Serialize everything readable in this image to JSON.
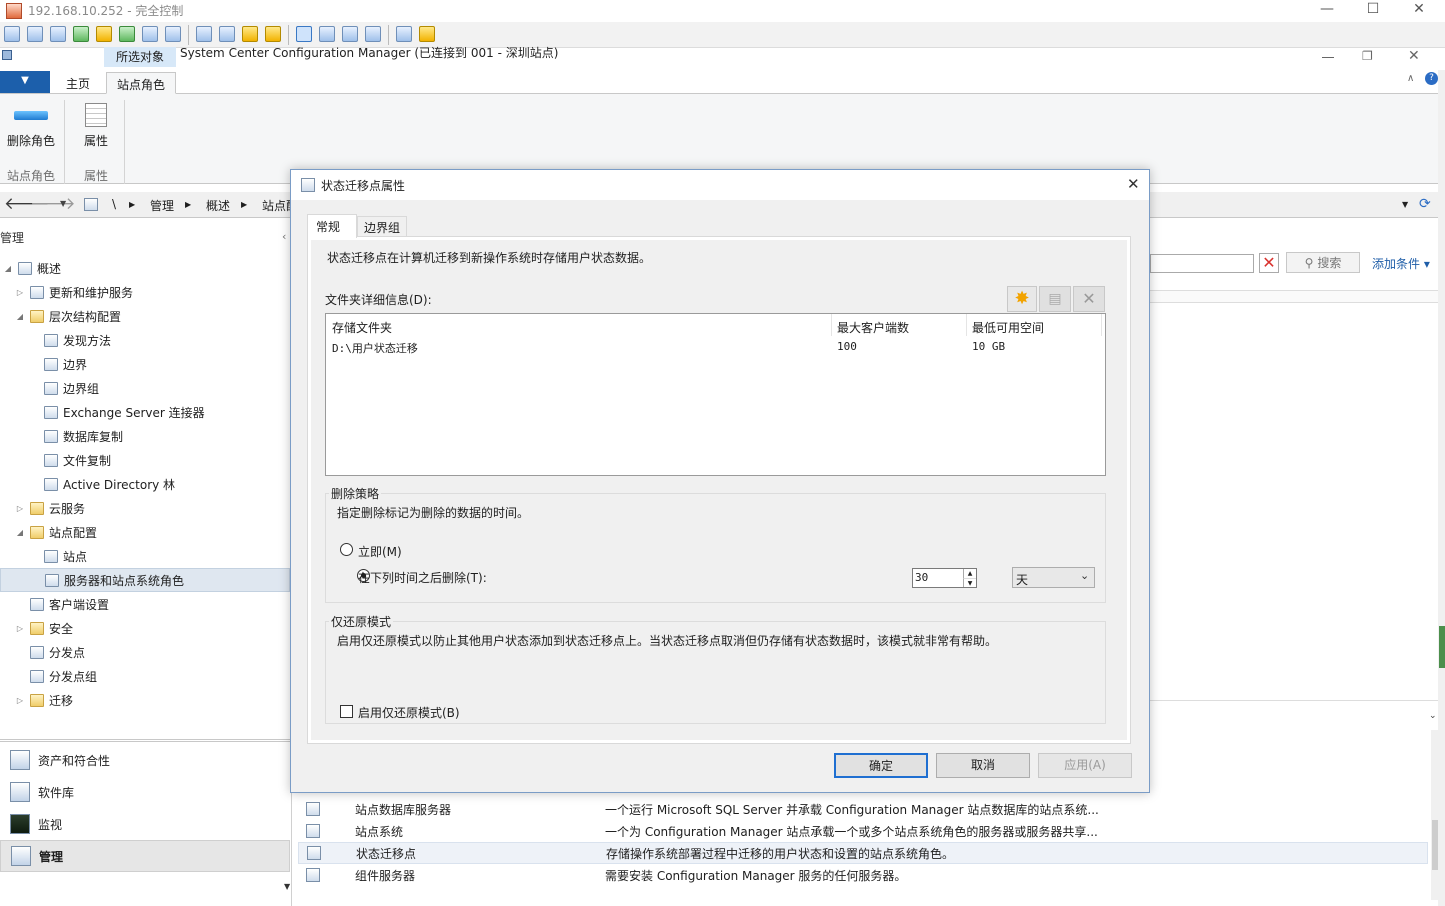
{
  "remote_window": {
    "title": "192.168.10.252 - 完全控制",
    "minimize": "—",
    "maximize": "☐",
    "close": "✕"
  },
  "app": {
    "title": "System Center Configuration Manager (已连接到 001 - 深圳站点)",
    "restore": "❐",
    "close": "✕"
  },
  "ribbon": {
    "file_button": "▼",
    "context_tab": "所选对象",
    "tabs": [
      "主页",
      "站点角色"
    ],
    "groups": [
      {
        "button": "删除角色",
        "label": "站点角色"
      },
      {
        "button": "属性",
        "label": "属性"
      }
    ]
  },
  "address": {
    "root": "\\",
    "crumbs": [
      "管理",
      "概述",
      "站点配"
    ]
  },
  "nav": {
    "header": "管理",
    "tree": [
      {
        "label": "概述",
        "level": 0,
        "exp": "◢",
        "icon": "overview-icon"
      },
      {
        "label": "更新和维护服务",
        "level": 1,
        "exp": "▷",
        "icon": "update-icon"
      },
      {
        "label": "层次结构配置",
        "level": 1,
        "exp": "◢",
        "icon": "folder-icon"
      },
      {
        "label": "发现方法",
        "level": 2,
        "exp": "",
        "icon": "discovery-icon"
      },
      {
        "label": "边界",
        "level": 2,
        "exp": "",
        "icon": "boundary-icon"
      },
      {
        "label": "边界组",
        "level": 2,
        "exp": "",
        "icon": "boundary-group-icon"
      },
      {
        "label": "Exchange Server 连接器",
        "level": 2,
        "exp": "",
        "icon": "exchange-icon"
      },
      {
        "label": "数据库复制",
        "level": 2,
        "exp": "",
        "icon": "database-icon"
      },
      {
        "label": "文件复制",
        "level": 2,
        "exp": "",
        "icon": "file-replication-icon"
      },
      {
        "label": "Active Directory 林",
        "level": 2,
        "exp": "",
        "icon": "active-directory-icon"
      },
      {
        "label": "云服务",
        "level": 1,
        "exp": "▷",
        "icon": "folder-icon"
      },
      {
        "label": "站点配置",
        "level": 1,
        "exp": "◢",
        "icon": "folder-icon"
      },
      {
        "label": "站点",
        "level": 2,
        "exp": "",
        "icon": "site-icon"
      },
      {
        "label": "服务器和站点系统角色",
        "level": 2,
        "exp": "",
        "icon": "server-role-icon",
        "selected": true
      },
      {
        "label": "客户端设置",
        "level": 1,
        "exp": "",
        "icon": "client-settings-icon"
      },
      {
        "label": "安全",
        "level": 1,
        "exp": "▷",
        "icon": "folder-icon"
      },
      {
        "label": "分发点",
        "level": 1,
        "exp": "",
        "icon": "distribution-point-icon"
      },
      {
        "label": "分发点组",
        "level": 1,
        "exp": "",
        "icon": "distribution-group-icon"
      },
      {
        "label": "迁移",
        "level": 1,
        "exp": "▷",
        "icon": "folder-icon"
      }
    ],
    "workspaces": [
      {
        "label": "资产和符合性",
        "icon": "assets-icon"
      },
      {
        "label": "软件库",
        "icon": "software-library-icon"
      },
      {
        "label": "监视",
        "icon": "monitoring-icon"
      },
      {
        "label": "管理",
        "icon": "administration-icon",
        "selected": true
      }
    ]
  },
  "search": {
    "search_button": "搜索",
    "add_criteria": "添加条件 ▾"
  },
  "role_list": [
    {
      "name": "站点数据库服务器",
      "desc": "一个运行 Microsoft SQL Server 并承载 Configuration Manager 站点数据库的站点系统..."
    },
    {
      "name": "站点系统",
      "desc": "一个为 Configuration Manager 站点承载一个或多个站点系统角色的服务器或服务器共享..."
    },
    {
      "name": "状态迁移点",
      "desc": "存储操作系统部署过程中迁移的用户状态和设置的站点系统角色。",
      "selected": true
    },
    {
      "name": "组件服务器",
      "desc": "需要安装 Configuration Manager 服务的任何服务器。"
    }
  ],
  "dialog": {
    "title": "状态迁移点属性",
    "close": "✕",
    "tabs": [
      "常规",
      "边界组"
    ],
    "description": "状态迁移点在计算机迁移到新操作系统时存储用户状态数据。",
    "folder_label": "文件夹详细信息(D):",
    "columns": [
      "存储文件夹",
      "最大客户端数",
      "最低可用空间"
    ],
    "rows": [
      [
        "D:\\用户状态迁移",
        "100",
        "10 GB"
      ]
    ],
    "deletion_group": "删除策略",
    "deletion_desc": "指定删除标记为删除的数据的时间。",
    "radio_immediate": "立即(M)",
    "radio_after": "在下列时间之后删除(T):",
    "delete_after_value": "30",
    "delete_after_unit": "天",
    "restore_group": "仅还原模式",
    "restore_desc": "启用仅还原模式以防止其他用户状态添加到状态迁移点上。当状态迁移点取消但仍存储有状态数据时，该模式就非常有帮助。",
    "restore_checkbox": "启用仅还原模式(B)",
    "buttons": {
      "ok": "确定",
      "cancel": "取消",
      "apply": "应用(A)"
    }
  }
}
